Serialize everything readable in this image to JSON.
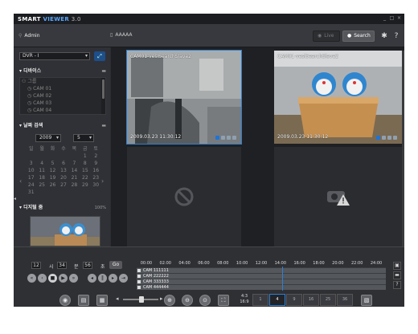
{
  "app": {
    "title_prefix": "SMART",
    "title_brand": "VIEWER",
    "version": "3.0"
  },
  "window_buttons": [
    "_",
    "□",
    "×"
  ],
  "header": {
    "user": "Admin",
    "site": "AAAAA",
    "live_label": "Live",
    "search_label": "Search"
  },
  "left": {
    "dvr_select": "DVR - I",
    "device_section": "디바이스",
    "group_label": "그룹",
    "cameras": [
      "CAM 01",
      "CAM 02",
      "CAM 03",
      "CAM 04"
    ],
    "date_section": "날짜 검색",
    "year": "2009",
    "month": "5",
    "weekdays": [
      "일",
      "월",
      "화",
      "수",
      "목",
      "금",
      "토"
    ],
    "weeks": [
      [
        "",
        "",
        "",
        "",
        "",
        "1",
        "2"
      ],
      [
        "3",
        "4",
        "5",
        "6",
        "7",
        "8",
        "9"
      ],
      [
        "10",
        "11",
        "12",
        "13",
        "14",
        "15",
        "16"
      ],
      [
        "17",
        "18",
        "19",
        "20",
        "21",
        "22",
        "23"
      ],
      [
        "24",
        "25",
        "26",
        "27",
        "28",
        "29",
        "30"
      ],
      [
        "31",
        "",
        "",
        "",
        "",
        "",
        ""
      ]
    ],
    "digital_zoom": "디지털 줌",
    "zoom_percent": "100%"
  },
  "views": [
    {
      "title": "CAM01-vesiSearchSlave2",
      "timestamp": "2009.03.23 11:30:12"
    },
    {
      "title": "CAM01-vesiSearchSlave2",
      "timestamp": "2009.03.23 11:30:12"
    }
  ],
  "time_controls": {
    "hour": "12",
    "hour_unit": "시",
    "minute": "34",
    "minute_unit": "분",
    "second": "56",
    "second_unit": "초",
    "go_label": "Go"
  },
  "timeline": {
    "hours": [
      "00:00",
      "02:00",
      "04:00",
      "06:00",
      "08:00",
      "10:00",
      "12:00",
      "14:00",
      "16:00",
      "18:00",
      "20:00",
      "22:00",
      "24:00"
    ],
    "channels": [
      "CAM 111111",
      "CAM 222222",
      "CAM 333333",
      "CAM 444444"
    ]
  },
  "layout_options": [
    "1",
    "4",
    "9",
    "16",
    "25",
    "36"
  ],
  "ratio": [
    "4:3",
    "16:9"
  ],
  "colors": {
    "accent": "#2a7fd8",
    "background": "#2c2d31",
    "selected_border": "#2a7fd8"
  }
}
